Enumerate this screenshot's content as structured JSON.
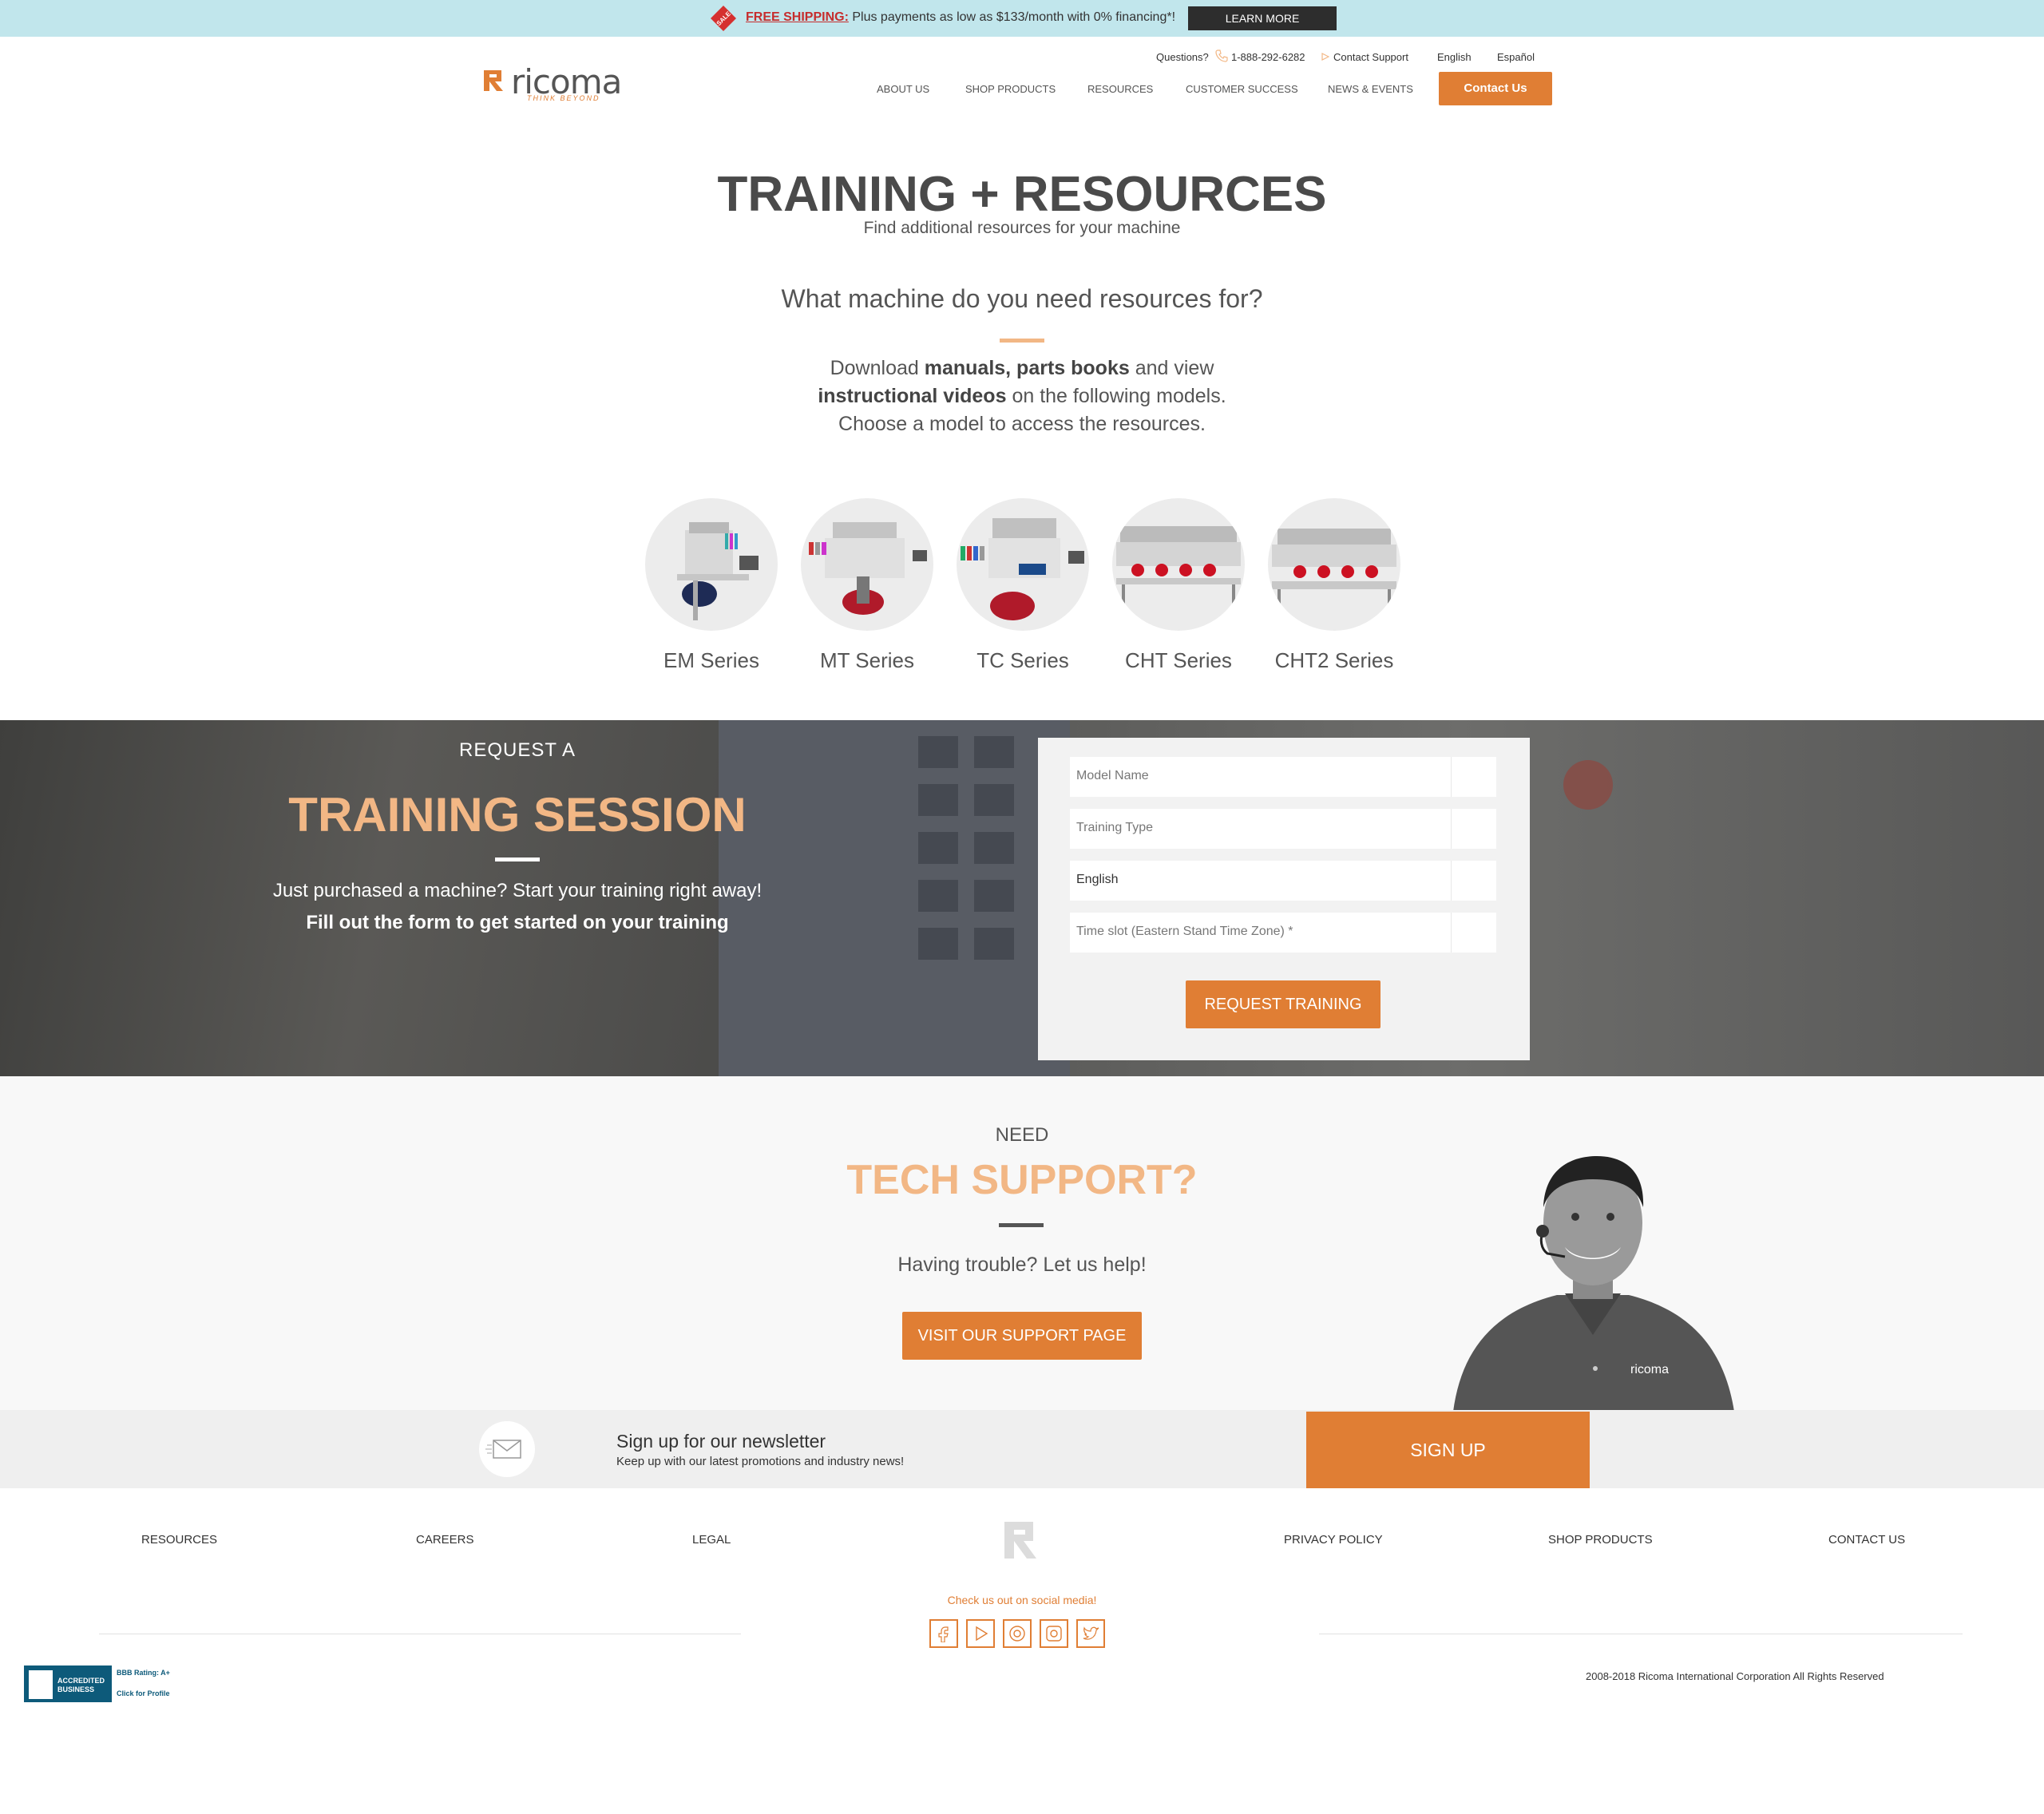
{
  "promo": {
    "free_shipping": "FREE SHIPPING:",
    "text": " Plus payments as low as $133/month with 0% financing*!",
    "button": "LEARN MORE",
    "tag_icon": "sale-tag-icon"
  },
  "header": {
    "logo_word": "ricoma",
    "logo_tagline": "THINK BEYOND",
    "questions": "Questions?",
    "phone": "1-888-292-6282",
    "contact_support": "Contact Support",
    "lang_english": "English",
    "lang_spanish": "Español",
    "nav": [
      "ABOUT US",
      "SHOP PRODUCTS",
      "RESOURCES",
      "CUSTOMER SUCCESS",
      "NEWS & EVENTS"
    ],
    "contact_button": "Contact Us",
    "accent_color": "#e07e34"
  },
  "hero": {
    "title": "TRAINING + RESOURCES",
    "subtitle": "Find additional resources for your machine",
    "question": "What machine do you need resources for?",
    "body_1": "Download ",
    "body_bold_1": "manuals, parts books",
    "body_2": " and view",
    "body_bold_2": "instructional videos",
    "body_3": " on the following models.",
    "body_4": "Choose a model to access the resources."
  },
  "series": [
    "EM Series",
    "MT Series",
    "TC Series",
    "CHT Series",
    "CHT2 Series"
  ],
  "training": {
    "kicker": "REQUEST A",
    "title": "TRAINING SESSION",
    "line1": "Just purchased a machine? Start your training right away!",
    "line2": "Fill out the form to get started on your training",
    "fields": {
      "model_name": "Model Name",
      "training_type": "Training Type",
      "language": "English",
      "time_slot": "Time slot (Eastern Stand Time Zone) *"
    },
    "button": "REQUEST TRAINING"
  },
  "tech": {
    "kicker": "NEED",
    "title": "TECH SUPPORT?",
    "body": "Having trouble? Let us help!",
    "button": "VISIT OUR SUPPORT PAGE",
    "shirt_logo": "ricoma"
  },
  "newsletter": {
    "title": "Sign up for our newsletter",
    "subtitle": "Keep up with our latest promotions and industry news!",
    "button": "SIGN UP"
  },
  "footer": {
    "links_left": [
      "RESOURCES",
      "CAREERS",
      "LEGAL"
    ],
    "links_right": [
      "PRIVACY POLICY",
      "SHOP PRODUCTS",
      "CONTACT US"
    ],
    "social_label": "Check us out on social media!",
    "social": [
      "facebook-icon",
      "youtube-icon",
      "pinterest-icon",
      "instagram-icon",
      "twitter-icon"
    ],
    "copyright": "2008-2018 Ricoma International Corporation   All Rights Reserved",
    "bbb_accredited": "ACCREDITED BUSINESS",
    "bbb_rating": "BBB Rating: A+",
    "bbb_profile": "Click for Profile"
  }
}
